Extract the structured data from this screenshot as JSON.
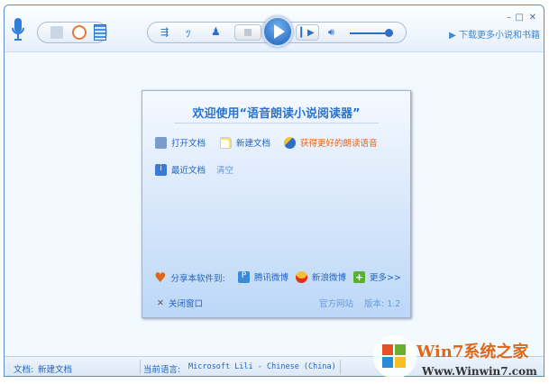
{
  "toolbar": {
    "download_link": "下载更多小说和书籍",
    "window_controls": {
      "minimize": "–",
      "maximize": "□",
      "close": "✕"
    }
  },
  "dialog": {
    "title": "欢迎使用“语音朗读小说阅读器”",
    "open_doc": "打开文档",
    "new_doc": "新建文档",
    "get_voices": "获得更好的朗读语音",
    "recent_docs": "最近文档",
    "clear": "清空",
    "share_label": "分享本软件到:",
    "tencent": "腾讯微博",
    "sina": "新浪微博",
    "more": "更多>>",
    "close": "关闭窗口",
    "website": "官方网站",
    "version": "版本: 1.2"
  },
  "statusbar": {
    "doc_label": "文档:",
    "doc_value": "新建文档",
    "lang_label": "当前语言:",
    "lang_value": "Microsoft Lili - Chinese (China)"
  },
  "watermark": {
    "brand": "Win7系统之家",
    "url": "Www.Winwin7.com"
  },
  "colors": {
    "accent": "#2366bf",
    "orange": "#e0661a",
    "border": "#5a8fd0"
  },
  "player": {
    "volume_fraction": 0.9
  }
}
